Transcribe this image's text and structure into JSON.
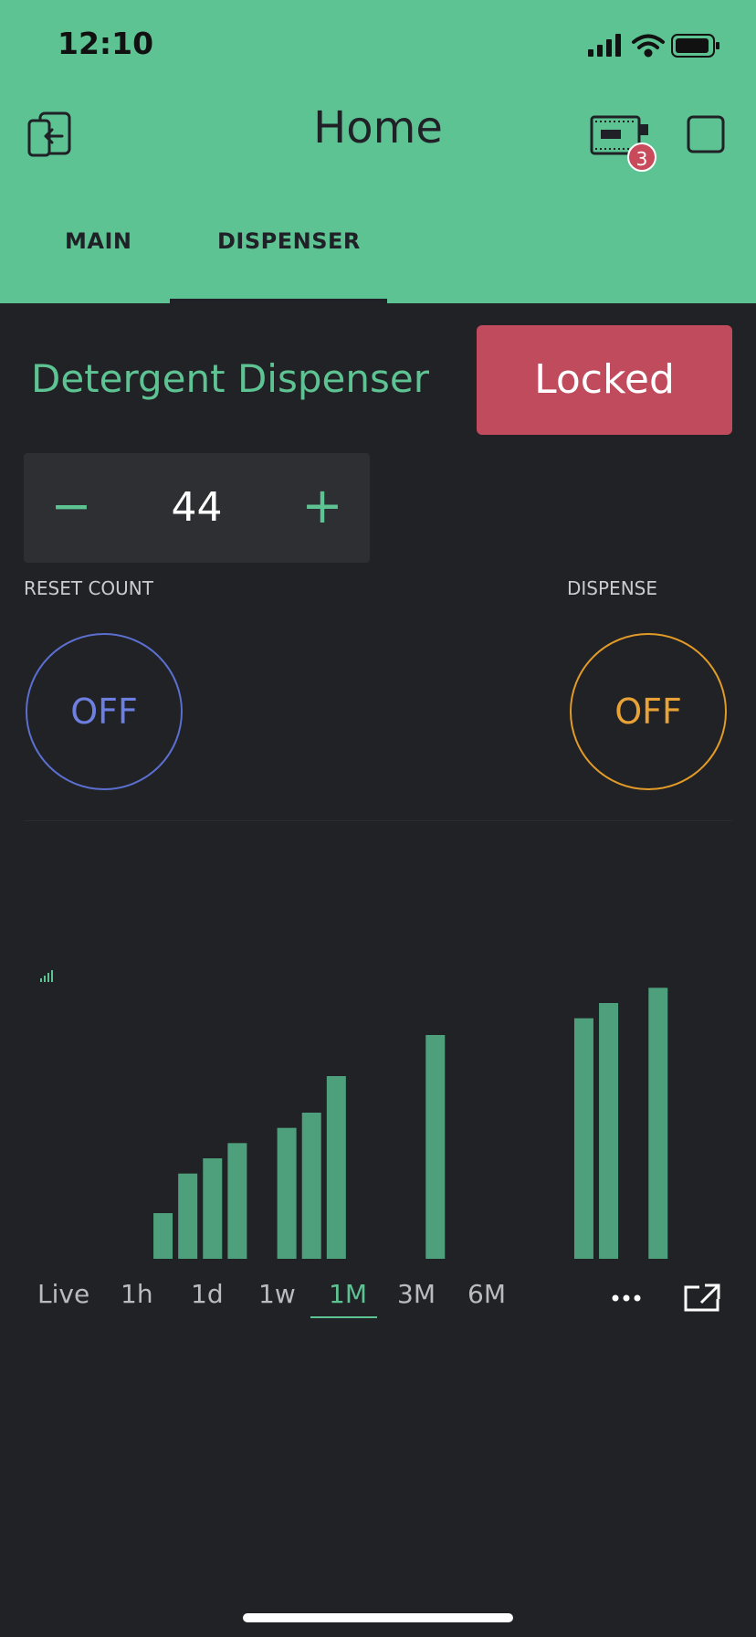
{
  "status_bar": {
    "time": "12:10"
  },
  "header": {
    "title": "Home",
    "devices_badge": "3",
    "tabs": [
      {
        "label": "MAIN",
        "active": false
      },
      {
        "label": "DISPENSER",
        "active": true
      }
    ]
  },
  "dispenser": {
    "title": "Detergent Dispenser",
    "lock_button": "Locked",
    "stepper": {
      "value": "44",
      "minus": "−",
      "plus": "+"
    },
    "reset_count": {
      "label": "RESET COUNT",
      "state": "OFF"
    },
    "dispense": {
      "label": "DISPENSE",
      "state": "OFF"
    }
  },
  "chart_data": {
    "type": "bar",
    "title": "",
    "xlabel": "",
    "ylabel": "",
    "x": [
      5,
      6,
      7,
      8,
      10,
      11,
      12,
      16,
      22,
      23,
      25
    ],
    "values": [
      3,
      5.6,
      6.6,
      7.6,
      8.6,
      9.6,
      12,
      14.7,
      15.8,
      16.8,
      17.8
    ],
    "xlim": [
      0,
      27
    ],
    "ylim": [
      0,
      18
    ],
    "grid": false,
    "bar_color": "#4e9f7b"
  },
  "range_tabs": [
    "Live",
    "1h",
    "1d",
    "1w",
    "1M",
    "3M",
    "6M"
  ],
  "range_active": "1M",
  "colors": {
    "accent": "#5ec393",
    "background": "#212226",
    "locked": "#c04b5c",
    "reset": "#5b6fd0",
    "dispense": "#e29b27"
  }
}
